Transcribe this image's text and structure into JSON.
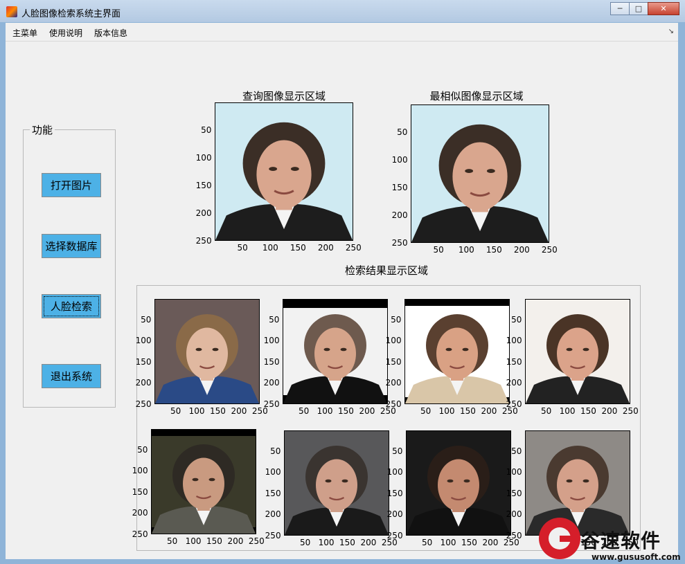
{
  "window": {
    "title": "人脸图像检索系统主界面",
    "minimize": "─",
    "maximize": "□",
    "close": "✕"
  },
  "menu": {
    "items": [
      "主菜单",
      "使用说明",
      "版本信息"
    ],
    "overflow_icon": "↘"
  },
  "panel": {
    "title": "功能",
    "buttons": [
      "打开图片",
      "选择数据库",
      "人脸检索",
      "退出系统"
    ]
  },
  "query_axes": {
    "title": "查询图像显示区域",
    "yticks": [
      "50",
      "100",
      "150",
      "200",
      "250"
    ],
    "xticks": [
      "50",
      "100",
      "150",
      "200",
      "250"
    ]
  },
  "best_axes": {
    "title": "最相似图像显示区域",
    "yticks": [
      "50",
      "100",
      "150",
      "200",
      "250"
    ],
    "xticks": [
      "50",
      "100",
      "150",
      "200",
      "250"
    ]
  },
  "results": {
    "title": "检索结果显示区域",
    "yticks": [
      "50",
      "100",
      "150",
      "200",
      "250"
    ],
    "xticks": [
      "50",
      "100",
      "150",
      "200",
      "250"
    ],
    "count": 8
  },
  "watermark": {
    "brand": "谷速软件",
    "url": "www.gususoft.com"
  },
  "colors": {
    "button_fill": "#4db1e6",
    "window_bg": "#f0f0f0",
    "logo_red": "#d51e2a"
  }
}
